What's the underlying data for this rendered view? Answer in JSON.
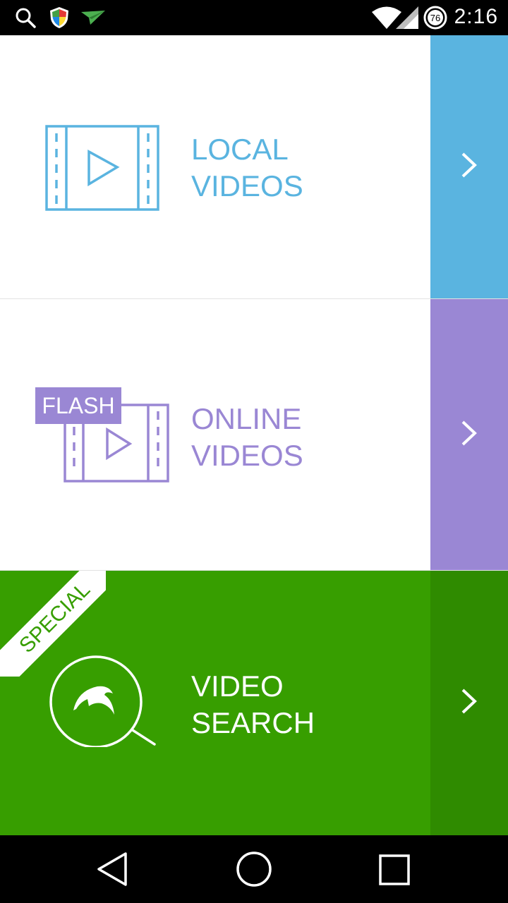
{
  "status_bar": {
    "time": "2:16",
    "battery_level": "76",
    "icons": [
      "search-icon",
      "shield-icon",
      "plane-notification-icon",
      "wifi-icon",
      "signal-icon",
      "battery-icon"
    ]
  },
  "rows": [
    {
      "id": "local",
      "line1": "LOCAL",
      "line2": "VIDEOS",
      "accent": "#5ab4e0",
      "icon": "film-play-icon",
      "arrow": "chevron-right-icon"
    },
    {
      "id": "online",
      "line1": "ONLINE",
      "line2": "VIDEOS",
      "badge": "FLASH",
      "accent": "#9a87d4",
      "icon": "flash-film-icon",
      "arrow": "chevron-right-icon"
    },
    {
      "id": "search",
      "line1": "VIDEO",
      "line2": "SEARCH",
      "ribbon": "SPECIAL",
      "accent": "#379e00",
      "icon": "dolphin-search-icon",
      "arrow": "chevron-right-icon"
    }
  ],
  "nav_bar": {
    "icons": [
      "back-icon",
      "home-icon",
      "recents-icon"
    ]
  }
}
